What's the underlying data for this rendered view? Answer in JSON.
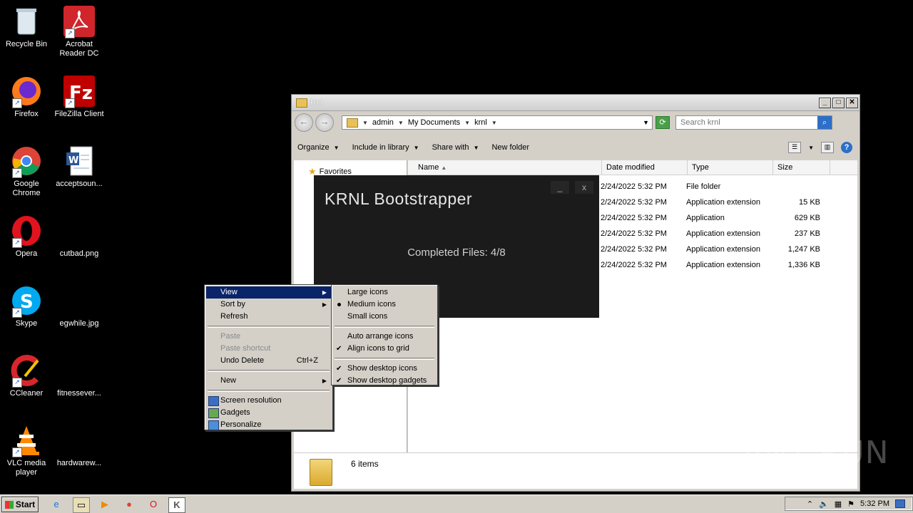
{
  "desktop": {
    "icons": [
      {
        "label": "Recycle Bin",
        "icon": "recycle-bin-icon"
      },
      {
        "label": "Acrobat Reader DC",
        "icon": "acrobat-icon"
      },
      {
        "label": "Firefox",
        "icon": "firefox-icon"
      },
      {
        "label": "FileZilla Client",
        "icon": "filezilla-icon"
      },
      {
        "label": "Google Chrome",
        "icon": "chrome-icon"
      },
      {
        "label": "acceptsoun...",
        "icon": "word-document-icon"
      },
      {
        "label": "Opera",
        "icon": "opera-icon"
      },
      {
        "label": "cutbad.png",
        "icon": "image-file-icon"
      },
      {
        "label": "Skype",
        "icon": "skype-icon"
      },
      {
        "label": "egwhile.jpg",
        "icon": "image-file-icon"
      },
      {
        "label": "CCleaner",
        "icon": "ccleaner-icon"
      },
      {
        "label": "fitnessever...",
        "icon": "file-icon"
      },
      {
        "label": "VLC media player",
        "icon": "vlc-icon"
      },
      {
        "label": "hardwarew...",
        "icon": "file-icon"
      }
    ]
  },
  "explorer": {
    "title": "krnl",
    "address": {
      "segments": [
        "admin",
        "My Documents",
        "krnl"
      ]
    },
    "search": {
      "placeholder": "Search krnl"
    },
    "toolbar": {
      "organize": "Organize",
      "include": "Include in library",
      "share": "Share with",
      "new_folder": "New folder"
    },
    "nav": {
      "favorites": "Favorites"
    },
    "columns": {
      "name": "Name",
      "date": "Date modified",
      "type": "Type",
      "size": "Size"
    },
    "rows": [
      {
        "date": "2/24/2022 5:32 PM",
        "type": "File folder",
        "size": ""
      },
      {
        "date": "2/24/2022 5:32 PM",
        "type": "Application extension",
        "size": "15 KB"
      },
      {
        "date": "2/24/2022 5:32 PM",
        "type": "Application",
        "size": "629 KB"
      },
      {
        "date": "2/24/2022 5:32 PM",
        "type": "Application extension",
        "size": "237 KB"
      },
      {
        "date": "2/24/2022 5:32 PM",
        "type": "Application extension",
        "size": "1,247 KB"
      },
      {
        "date": "2/24/2022 5:32 PM",
        "type": "Application extension",
        "size": "1,336 KB"
      }
    ],
    "status": "6 items"
  },
  "krnl": {
    "title": "KRNL Bootstrapper",
    "minimize": "_",
    "close": "x",
    "status": "Completed Files: 4/8"
  },
  "context_menu": {
    "view": "View",
    "sort_by": "Sort by",
    "refresh": "Refresh",
    "paste": "Paste",
    "paste_shortcut": "Paste shortcut",
    "undo_delete": "Undo Delete",
    "undo_shortcut": "Ctrl+Z",
    "new": "New",
    "screen_resolution": "Screen resolution",
    "gadgets": "Gadgets",
    "personalize": "Personalize"
  },
  "view_submenu": {
    "large": "Large icons",
    "medium": "Medium icons",
    "small": "Small icons",
    "auto_arrange": "Auto arrange icons",
    "align": "Align icons to grid",
    "show_icons": "Show desktop icons",
    "show_gadgets": "Show desktop gadgets"
  },
  "taskbar": {
    "start": "Start",
    "clock": "5:32 PM"
  },
  "watermark": "ANY RUN"
}
